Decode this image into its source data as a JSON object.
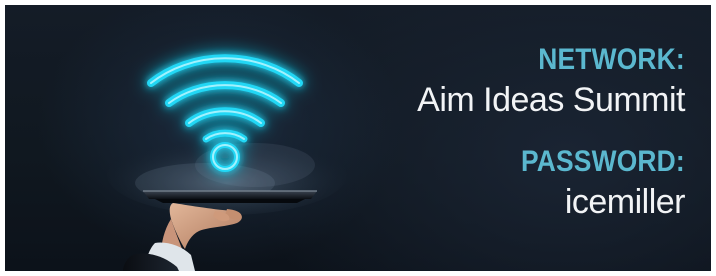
{
  "network": {
    "heading": "NETWORK:",
    "name": "Aim Ideas Summit"
  },
  "password": {
    "heading": "PASSWORD:",
    "value": "icemiller"
  },
  "colors": {
    "accent": "#5bb8cf",
    "wifi_glow": "#22d7f5",
    "background": "#121a24",
    "text": "#f2f4f6"
  },
  "icons": {
    "wifi": "wifi-icon",
    "tablet": "tablet-device",
    "hand": "hand-image"
  }
}
